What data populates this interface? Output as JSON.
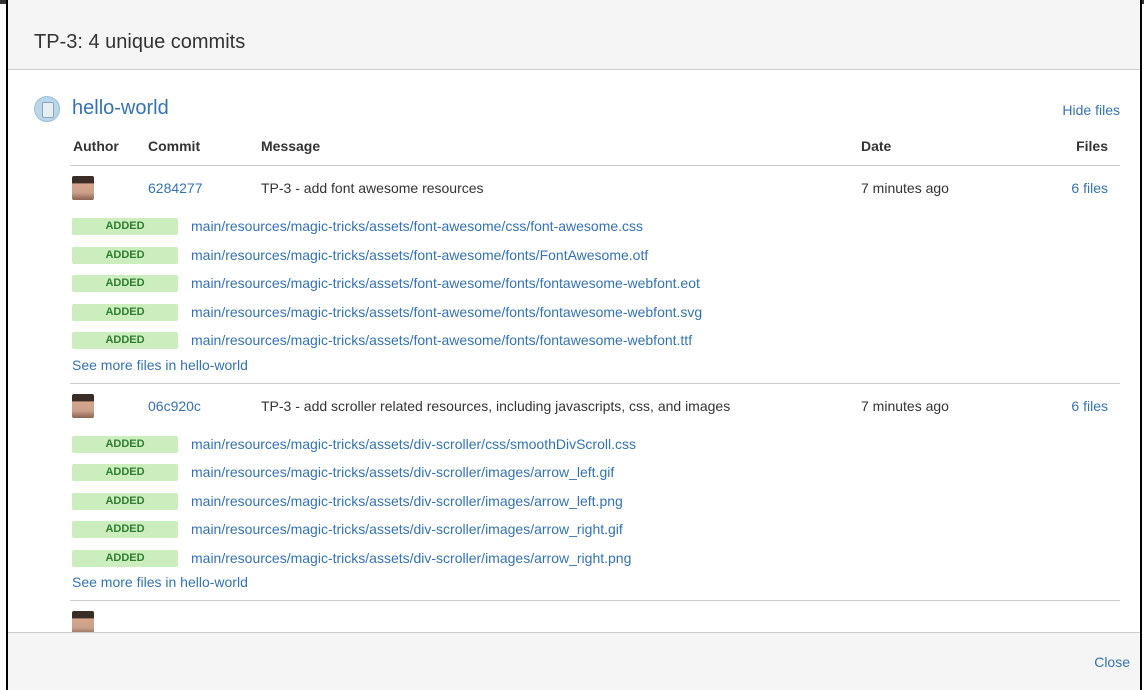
{
  "dialog": {
    "title": "TP-3: 4 unique commits",
    "close_label": "Close"
  },
  "repo": {
    "name": "hello-world",
    "hide_files_label": "Hide files",
    "icon": "repository-icon"
  },
  "table": {
    "headers": {
      "author": "Author",
      "commit": "Commit",
      "message": "Message",
      "date": "Date",
      "files": "Files"
    }
  },
  "commits": [
    {
      "hash": "6284277",
      "message": "TP-3 - add font awesome resources",
      "date": "7 minutes ago",
      "files_label": "6 files",
      "files": [
        {
          "status": "ADDED",
          "path": "main/resources/magic-tricks/assets/font-awesome/css/font-awesome.css"
        },
        {
          "status": "ADDED",
          "path": "main/resources/magic-tricks/assets/font-awesome/fonts/FontAwesome.otf"
        },
        {
          "status": "ADDED",
          "path": "main/resources/magic-tricks/assets/font-awesome/fonts/fontawesome-webfont.eot"
        },
        {
          "status": "ADDED",
          "path": "main/resources/magic-tricks/assets/font-awesome/fonts/fontawesome-webfont.svg"
        },
        {
          "status": "ADDED",
          "path": "main/resources/magic-tricks/assets/font-awesome/fonts/fontawesome-webfont.ttf"
        }
      ],
      "see_more": "See more files in hello-world"
    },
    {
      "hash": "06c920c",
      "message": "TP-3 - add scroller related resources, including javascripts, css, and images",
      "date": "7 minutes ago",
      "files_label": "6 files",
      "files": [
        {
          "status": "ADDED",
          "path": "main/resources/magic-tricks/assets/div-scroller/css/smoothDivScroll.css"
        },
        {
          "status": "ADDED",
          "path": "main/resources/magic-tricks/assets/div-scroller/images/arrow_left.gif"
        },
        {
          "status": "ADDED",
          "path": "main/resources/magic-tricks/assets/div-scroller/images/arrow_left.png"
        },
        {
          "status": "ADDED",
          "path": "main/resources/magic-tricks/assets/div-scroller/images/arrow_right.gif"
        },
        {
          "status": "ADDED",
          "path": "main/resources/magic-tricks/assets/div-scroller/images/arrow_right.png"
        }
      ],
      "see_more": "See more files in hello-world"
    }
  ],
  "colors": {
    "link": "#3572b0",
    "added_badge_bg": "#ccedbd",
    "added_badge_text": "#2f7d32",
    "header_bg": "#f5f5f5"
  }
}
